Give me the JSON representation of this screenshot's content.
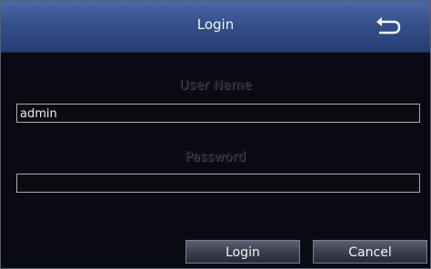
{
  "dialog": {
    "title": "Login",
    "back_icon": "return-arrow-icon"
  },
  "form": {
    "username_label": "User Name",
    "username_value": "admin",
    "password_label": "Password",
    "password_value": ""
  },
  "buttons": {
    "login_label": "Login",
    "cancel_label": "Cancel"
  },
  "colors": {
    "titlebar": "#35508a",
    "background": "#0a0b12"
  }
}
